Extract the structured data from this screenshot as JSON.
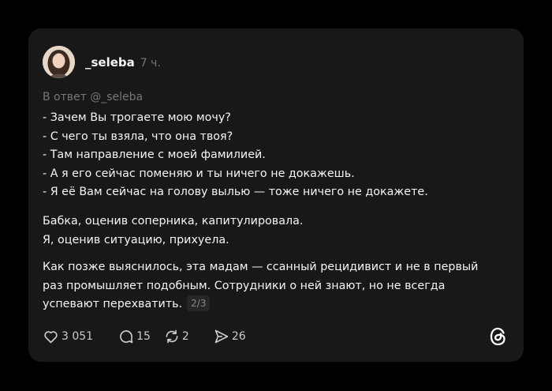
{
  "post": {
    "username": "_seleba",
    "time": "7 ч.",
    "reply_to": "В ответ @_seleba",
    "dialogue": [
      "- Зачем Вы трогаете мою мочу?",
      "- С чего ты взяла, что она твоя?",
      "- Там направление с моей фамилией.",
      "- А я его сейчас поменяю и ты ничего не докажешь.",
      "- Я её Вам сейчас на голову вылью — тоже ничего не докажете."
    ],
    "paragraph1": [
      "Бабка, оценив соперника, капитулировала.",
      "Я, оценив ситуацию, прихуела."
    ],
    "paragraph2": [
      "Как позже выяснилось, эта мадам — ссанный рецидивист и не в первый",
      "раз промышляет подобным. Сотрудники о ней знают, но не всегда",
      "успевают перехватить."
    ],
    "page_indicator": "2/3"
  },
  "actions": {
    "likes": "3 051",
    "comments": "15",
    "reposts": "2",
    "shares": "26"
  },
  "icons": {
    "like": "heart-icon",
    "comment": "comment-bubble-icon",
    "repost": "repost-icon",
    "share": "send-icon",
    "logo": "threads-logo-icon"
  },
  "colors": {
    "background": "#000000",
    "card": "#181818",
    "text": "#f3f5f7",
    "muted": "#777777"
  }
}
